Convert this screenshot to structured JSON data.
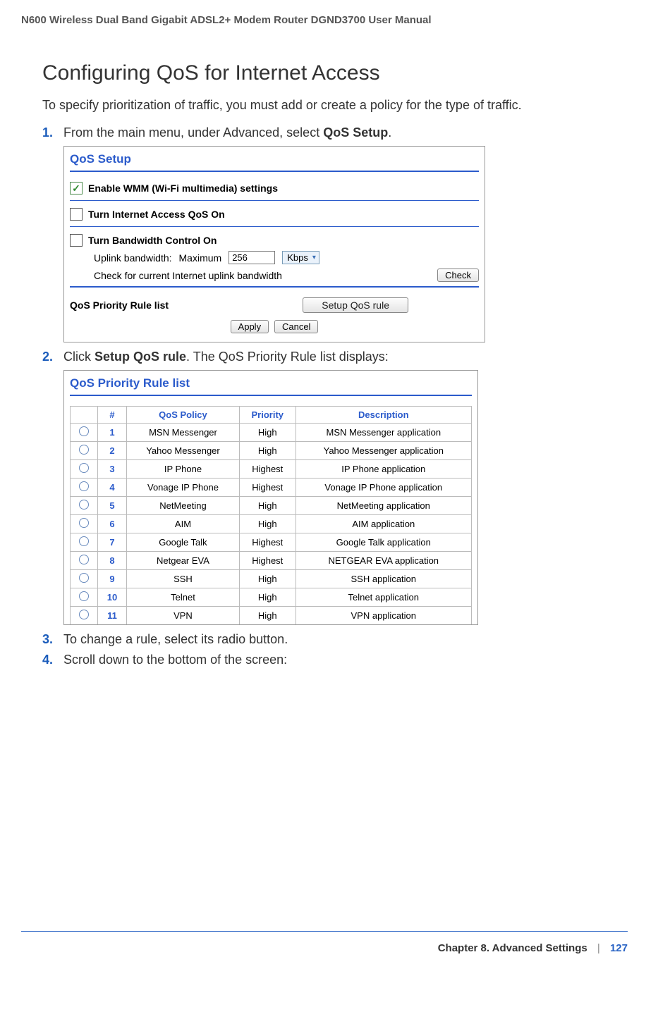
{
  "runningHeader": "N600 Wireless Dual Band Gigabit ADSL2+ Modem Router DGND3700 User Manual",
  "sectionTitle": "Configuring QoS for Internet Access",
  "intro": "To specify prioritization of traffic, you must add or create a policy for the type of traffic.",
  "steps": {
    "s1_pre": "From the main menu, under Advanced, select ",
    "s1_bold": "QoS Setup",
    "s1_post": ".",
    "s2_pre": "Click ",
    "s2_bold": "Setup QoS rule",
    "s2_post": ". The QoS Priority Rule list displays:",
    "s3": "To change a rule, select its radio button.",
    "s4": "Scroll down to the bottom of the screen:"
  },
  "screenshot1": {
    "title": "QoS Setup",
    "wmmLabel": "Enable WMM (Wi-Fi multimedia) settings",
    "internetQosLabel": "Turn Internet Access QoS On",
    "bwControlLabel": "Turn Bandwidth Control On",
    "uplinkLabel": "Uplink bandwidth:",
    "uplinkMode": "Maximum",
    "uplinkValue": "256",
    "uplinkUnit": "Kbps",
    "checkUplinkLabel": "Check for current Internet uplink bandwidth",
    "checkBtn": "Check",
    "priorityListLabel": "QoS Priority Rule list",
    "setupRuleBtn": "Setup QoS rule",
    "applyBtn": "Apply",
    "cancelBtn": "Cancel"
  },
  "screenshot2": {
    "title": "QoS Priority Rule list",
    "headers": {
      "num": "#",
      "policy": "QoS Policy",
      "priority": "Priority",
      "desc": "Description"
    },
    "rows": [
      {
        "n": "1",
        "policy": "MSN Messenger",
        "priority": "High",
        "desc": "MSN Messenger application"
      },
      {
        "n": "2",
        "policy": "Yahoo Messenger",
        "priority": "High",
        "desc": "Yahoo Messenger application"
      },
      {
        "n": "3",
        "policy": "IP Phone",
        "priority": "Highest",
        "desc": "IP Phone application"
      },
      {
        "n": "4",
        "policy": "Vonage IP Phone",
        "priority": "Highest",
        "desc": "Vonage IP Phone application"
      },
      {
        "n": "5",
        "policy": "NetMeeting",
        "priority": "High",
        "desc": "NetMeeting application"
      },
      {
        "n": "6",
        "policy": "AIM",
        "priority": "High",
        "desc": "AIM application"
      },
      {
        "n": "7",
        "policy": "Google Talk",
        "priority": "Highest",
        "desc": "Google Talk application"
      },
      {
        "n": "8",
        "policy": "Netgear EVA",
        "priority": "Highest",
        "desc": "NETGEAR EVA application"
      },
      {
        "n": "9",
        "policy": "SSH",
        "priority": "High",
        "desc": "SSH application"
      },
      {
        "n": "10",
        "policy": "Telnet",
        "priority": "High",
        "desc": "Telnet application"
      },
      {
        "n": "11",
        "policy": "VPN",
        "priority": "High",
        "desc": "VPN application"
      }
    ]
  },
  "footer": {
    "chapter": "Chapter 8.  Advanced Settings",
    "page": "127"
  }
}
